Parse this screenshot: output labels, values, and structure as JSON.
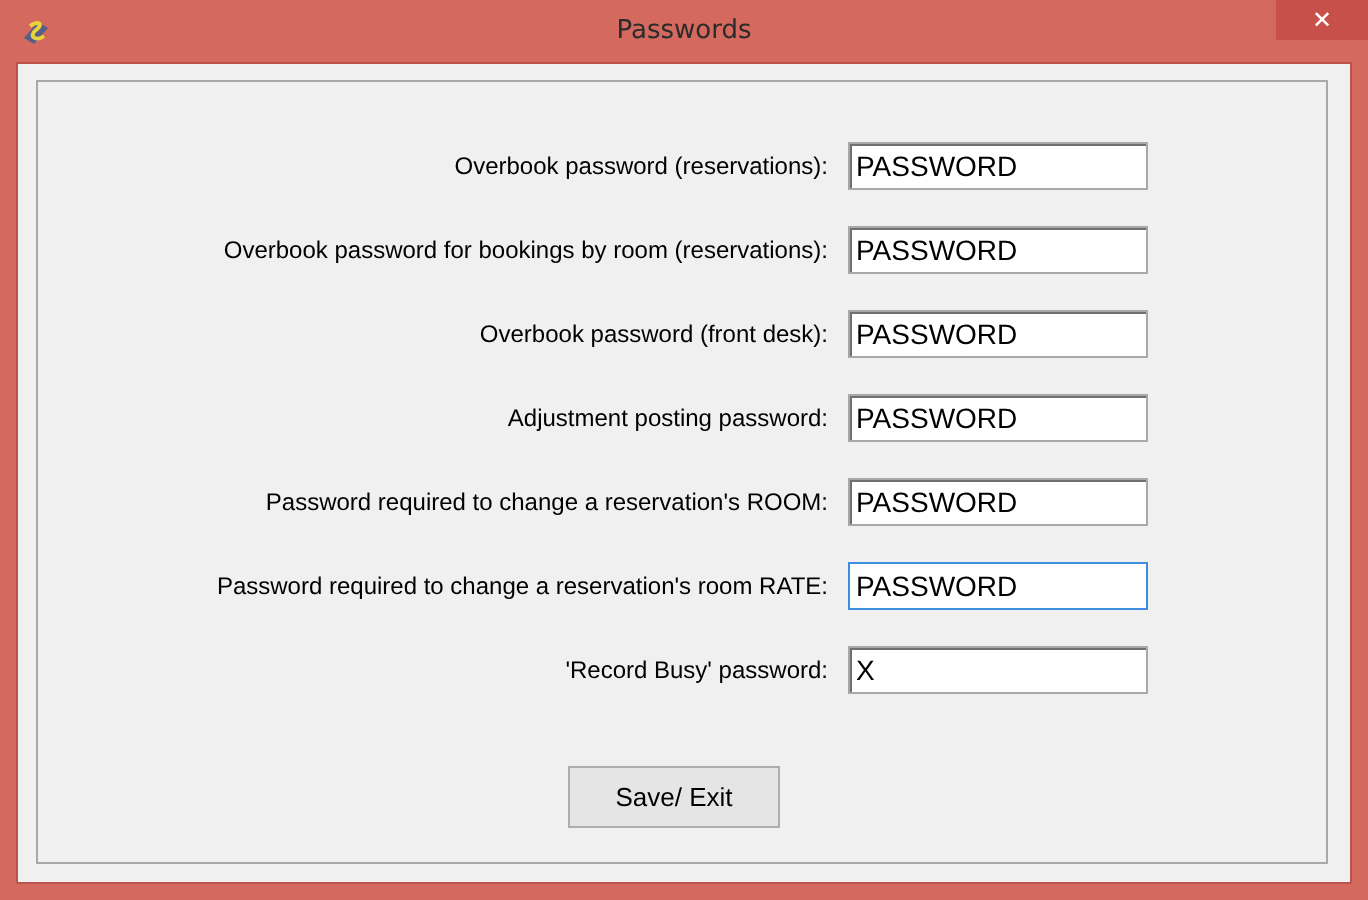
{
  "window": {
    "title": "Passwords",
    "close": "✕"
  },
  "fields": [
    {
      "label": "Overbook password (reservations):",
      "value": "PASSWORD",
      "focused": false
    },
    {
      "label": "Overbook password for bookings by room (reservations):",
      "value": "PASSWORD",
      "focused": false
    },
    {
      "label": "Overbook password (front desk):",
      "value": "PASSWORD",
      "focused": false
    },
    {
      "label": "Adjustment posting password:",
      "value": "PASSWORD",
      "focused": false
    },
    {
      "label": "Password required to change a reservation's ROOM:",
      "value": "PASSWORD",
      "focused": false
    },
    {
      "label": "Password required to change a reservation's room RATE:",
      "value": "PASSWORD",
      "focused": true
    },
    {
      "label": "'Record Busy' password:",
      "value": "X",
      "focused": false
    }
  ],
  "buttons": [
    "Save/ Exit"
  ]
}
